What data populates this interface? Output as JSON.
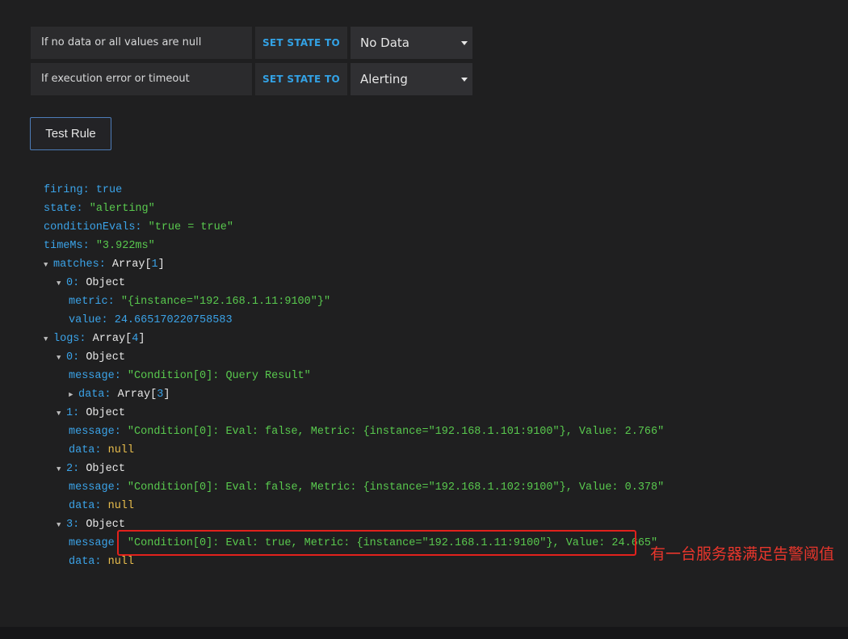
{
  "conditions": {
    "no_data": {
      "label": "If no data or all values are null",
      "set_state": "SET STATE TO",
      "value": "No Data"
    },
    "exec_error": {
      "label": "If execution error or timeout",
      "set_state": "SET STATE TO",
      "value": "Alerting"
    }
  },
  "test_button": {
    "label": "Test Rule"
  },
  "result": {
    "firing": {
      "key": "firing",
      "value": "true"
    },
    "state": {
      "key": "state",
      "value": "\"alerting\""
    },
    "conditionEvals": {
      "key": "conditionEvals",
      "value": "\"true = true\""
    },
    "timeMs": {
      "key": "timeMs",
      "value": "\"3.922ms\""
    },
    "matches": {
      "key": "matches",
      "type": "Array",
      "bracket_open": "[",
      "count": "1",
      "bracket_close": "]",
      "items": [
        {
          "index": "0",
          "type": "Object",
          "metric": {
            "key": "metric",
            "value": "\"{instance=\"192.168.1.11:9100\"}\""
          },
          "value": {
            "key": "value",
            "value": "24.665170220758583"
          }
        }
      ]
    },
    "logs": {
      "key": "logs",
      "type": "Array",
      "bracket_open": "[",
      "count": "4",
      "bracket_close": "]",
      "items": [
        {
          "index": "0",
          "type": "Object",
          "message": {
            "key": "message",
            "value": "\"Condition[0]: Query Result\""
          },
          "data": {
            "key": "data",
            "type": "Array",
            "bracket_open": "[",
            "count": "3",
            "bracket_close": "]"
          }
        },
        {
          "index": "1",
          "type": "Object",
          "message": {
            "key": "message",
            "value": "\"Condition[0]: Eval: false, Metric: {instance=\"192.168.1.101:9100\"}, Value: 2.766\""
          },
          "data": {
            "key": "data",
            "value": "null"
          }
        },
        {
          "index": "2",
          "type": "Object",
          "message": {
            "key": "message",
            "value": "\"Condition[0]: Eval: false, Metric: {instance=\"192.168.1.102:9100\"}, Value: 0.378\""
          },
          "data": {
            "key": "data",
            "value": "null"
          }
        },
        {
          "index": "3",
          "type": "Object",
          "message": {
            "key": "message",
            "value": "\"Condition[0]: Eval: true, Metric: {instance=\"192.168.1.11:9100\"}, Value: 24.665\""
          },
          "data": {
            "key": "data",
            "value": "null"
          }
        }
      ]
    }
  },
  "icons": {
    "expanded": "caret-down-icon",
    "collapsed": "caret-right-icon",
    "select": "chevron-down-icon"
  },
  "annotation": {
    "text": "有一台服务器满足告警阈值"
  },
  "colors": {
    "key": "#3ba3e8",
    "string": "#59c94e",
    "null": "#e8bd4c",
    "highlight": "#e2211c",
    "annotation": "#e8362c",
    "set_state": "#33a2e5"
  }
}
